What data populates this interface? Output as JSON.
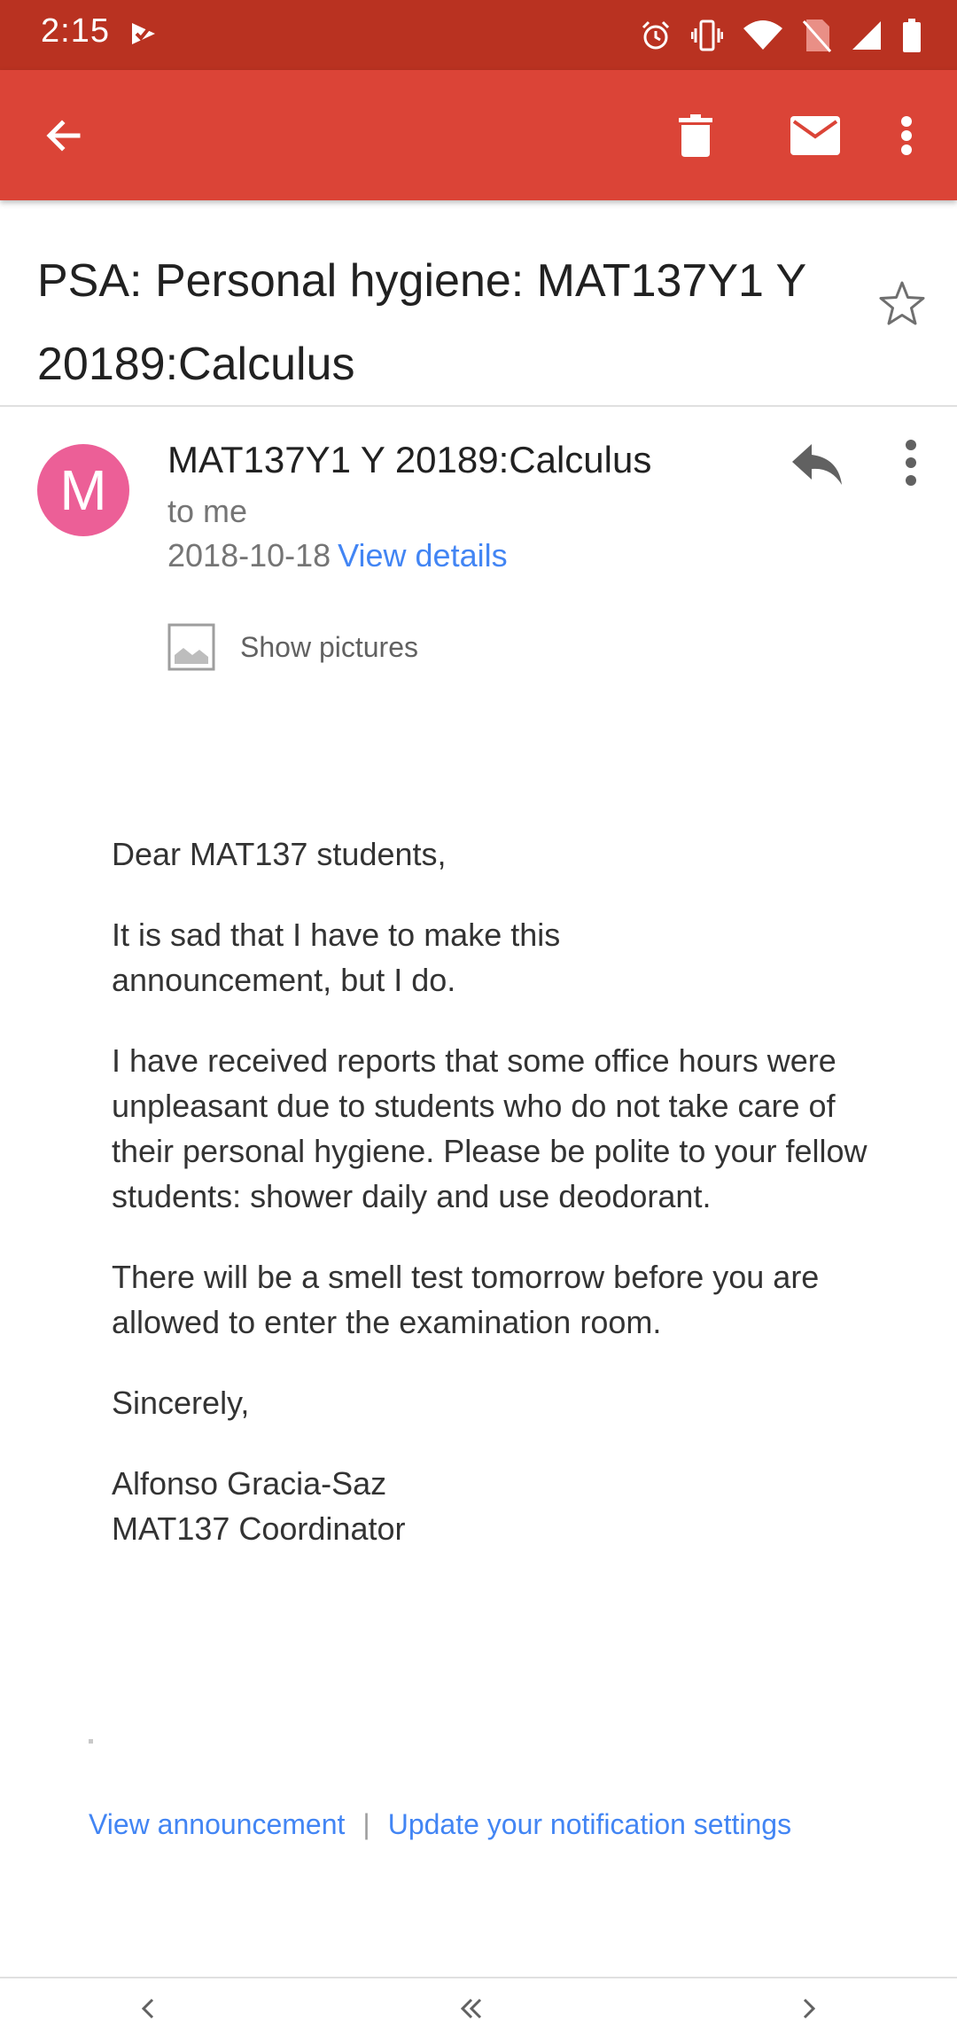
{
  "status_bar": {
    "time": "2:15",
    "icons": [
      "check-notification-icon",
      "alarm-icon",
      "vibrate-icon",
      "wifi-icon",
      "no-sim-icon",
      "signal-icon",
      "battery-icon"
    ]
  },
  "app_bar": {
    "actions": [
      "back-arrow-icon",
      "trash-icon",
      "mail-icon",
      "more-vert-icon"
    ]
  },
  "email": {
    "subject": "PSA: Personal hygiene: MAT137Y1 Y 20189:Calculus",
    "sender": {
      "initial": "M",
      "name": "MAT137Y1 Y 20189:Calculus",
      "recipient": "to me",
      "date": "2018-10-18",
      "view_details": "View details",
      "avatar_color": "#ec5f97"
    },
    "show_pictures": "Show pictures",
    "body": {
      "greeting": "Dear MAT137 students,",
      "p1": "It is sad that I have to make this announcement, but I do.",
      "p2": "I have received reports that some office hours were unpleasant due to students who do not take care of their personal hygiene.  Please be polite to your fellow students: shower daily and use deodorant.",
      "p3": "There will be a smell test tomorrow before you are allowed to enter the examination room.",
      "closing": "Sincerely,",
      "signature_name": "Alfonso Gracia-Saz",
      "signature_title": "MAT137 Coordinator"
    },
    "footer": {
      "view_announcement": "View announcement",
      "separator": "|",
      "notification_settings": "Update your notification settings"
    }
  },
  "colors": {
    "status_bar": "#b93221",
    "app_bar": "#db4437",
    "link": "#4285f4"
  }
}
